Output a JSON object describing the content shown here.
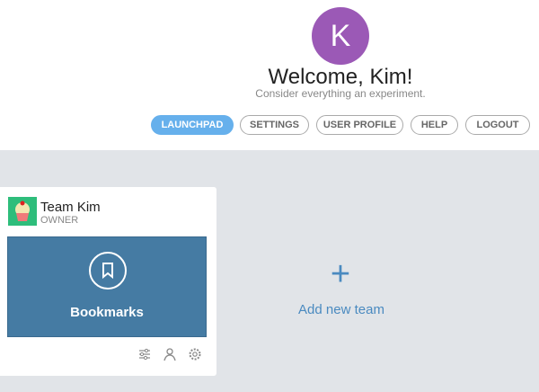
{
  "header": {
    "avatar_letter": "K",
    "avatar_color": "#9b59b6",
    "title": "Welcome, Kim!",
    "subtitle": "Consider everything an experiment."
  },
  "nav": [
    {
      "label": "LAUNCHPAD",
      "active": true
    },
    {
      "label": "SETTINGS"
    },
    {
      "label": "USER PROFILE"
    },
    {
      "label": "HELP"
    },
    {
      "label": "LOGOUT"
    }
  ],
  "team": {
    "name": "Team Kim",
    "role": "OWNER",
    "tile_label": "Bookmarks",
    "tile_icon": "bookmark-icon",
    "actions": [
      "sliders-icon",
      "user-icon",
      "gear-icon"
    ]
  },
  "add_team": {
    "label": "Add new team"
  }
}
